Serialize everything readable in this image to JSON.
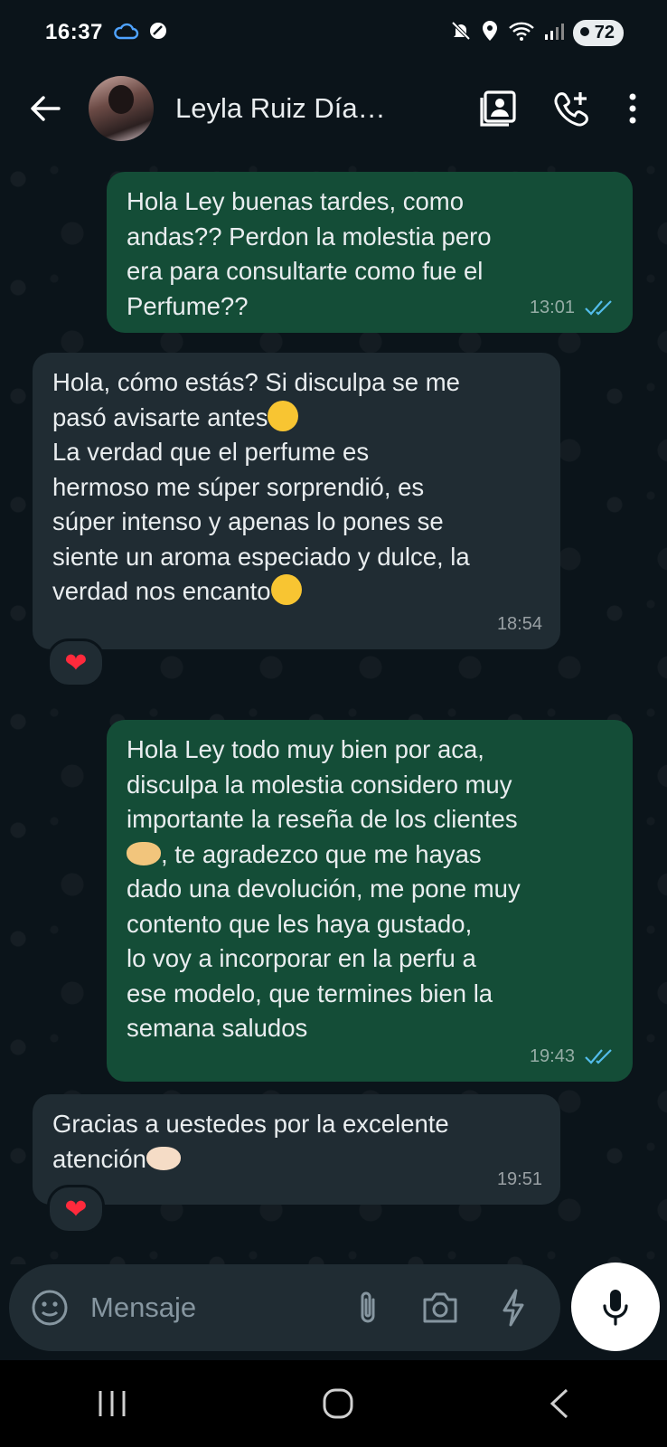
{
  "status_bar": {
    "time": "16:37",
    "battery": "72"
  },
  "header": {
    "contact_name": "Leyla Ruiz Día…"
  },
  "messages": [
    {
      "direction": "out",
      "text_lines": [
        "Hola Ley buenas tardes, como",
        "andas?? Perdon la molestia pero",
        "era para consultarte como fue el",
        "Perfume??"
      ],
      "time": "13:01"
    },
    {
      "direction": "in",
      "line1": "Hola, cómo estás? Si disculpa se me",
      "line2": "pasó avisarte antes",
      "lines_rest": [
        "La verdad que el perfume es",
        "hermoso me súper sorprendió, es",
        "súper intenso y apenas lo pones se",
        "siente un aroma especiado y dulce, la"
      ],
      "line_last": "verdad nos encanto",
      "time": "18:54",
      "reaction": "❤"
    },
    {
      "direction": "out",
      "line1": "Hola Ley todo muy bien por aca,",
      "line2": "disculpa la molestia considero muy",
      "line3": "importante la reseña de los clientes",
      "line4": ", te agradezco que me hayas",
      "lines_rest": [
        "dado una devolución, me pone muy",
        "contento que les haya gustado,",
        "lo voy a incorporar en la perfu a",
        "ese modelo, que termines bien la",
        "semana saludos"
      ],
      "time": "19:43"
    },
    {
      "direction": "in",
      "line1": "Gracias a uestedes por la excelente",
      "line2": "atención",
      "time": "19:51",
      "reaction": "❤"
    }
  ],
  "composer": {
    "placeholder": "Mensaje"
  },
  "colors": {
    "outgoing_bubble": "#144d37",
    "incoming_bubble": "#202c33",
    "background": "#0b141a",
    "read_ticks": "#53bdeb"
  },
  "icons": [
    "back-arrow-icon",
    "contacts-card-icon",
    "add-call-icon",
    "more-vert-icon",
    "sticker-icon",
    "attach-icon",
    "camera-icon",
    "bolt-icon",
    "mic-icon"
  ]
}
